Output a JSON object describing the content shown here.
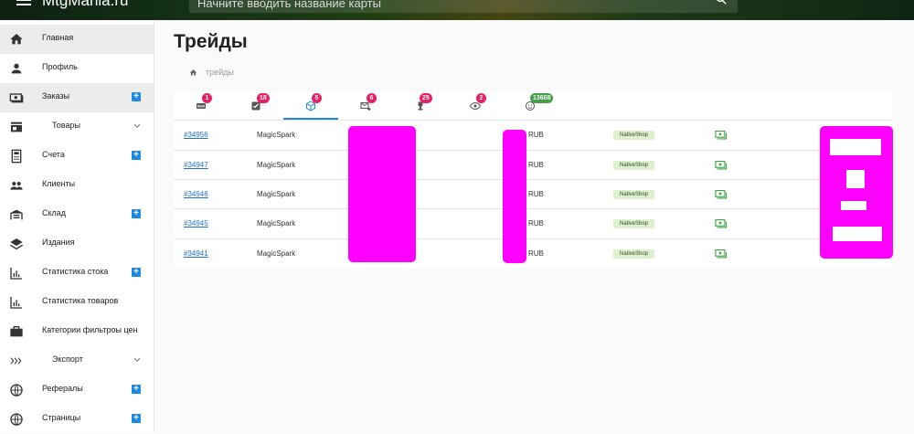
{
  "header": {
    "brand": "MtgMania.ru",
    "search_placeholder": "Начните вводить название карты",
    "menu_icon": "menu-icon",
    "search_icon": "search-icon"
  },
  "sidebar": {
    "items": [
      {
        "label": "Главная",
        "icon": "home-icon",
        "active": true
      },
      {
        "label": "Профиль",
        "icon": "person-icon"
      },
      {
        "label": "Заказы",
        "icon": "money-icon",
        "plus": true
      },
      {
        "label": "Товары",
        "icon": "store-icon",
        "expand": true
      },
      {
        "label": "Счета",
        "icon": "calculator-icon",
        "plus": true
      },
      {
        "label": "Клиенты",
        "icon": "people-icon"
      },
      {
        "label": "Склад",
        "icon": "warehouse-icon",
        "plus": true
      },
      {
        "label": "Издания",
        "icon": "layers-icon"
      },
      {
        "label": "Статистика стока",
        "icon": "chart-icon",
        "plus": true
      },
      {
        "label": "Статистика товаров",
        "icon": "chart-icon"
      },
      {
        "label": "Категории фильтроы цен",
        "icon": "briefcase-icon"
      },
      {
        "label": "Экспорт",
        "icon": "chevrons-right-icon",
        "expand": true
      },
      {
        "label": "Рефералы",
        "icon": "globe-icon",
        "plus": true
      },
      {
        "label": "Страницы",
        "icon": "globe-icon",
        "plus": true
      }
    ]
  },
  "main": {
    "title": "Трейды",
    "breadcrumb": "трейды",
    "tabs": [
      {
        "icon": "new-icon",
        "badge": "1",
        "badge_color": "#e91e63"
      },
      {
        "icon": "check-box-icon",
        "badge": "18",
        "badge_color": "#e91e63"
      },
      {
        "icon": "package-icon",
        "badge": "5",
        "badge_color": "#e91e63",
        "active": true
      },
      {
        "icon": "mail-forward-icon",
        "badge": "6",
        "badge_color": "#e91e63"
      },
      {
        "icon": "trophy-icon",
        "badge": "25",
        "badge_color": "#e91e63"
      },
      {
        "icon": "eye-check-icon",
        "badge": "2",
        "badge_color": "#e91e63"
      },
      {
        "icon": "smile-check-icon",
        "badge": "13668",
        "badge_color": "#43a047"
      }
    ],
    "rows": [
      {
        "id": "#34956",
        "client": "MagicSpark",
        "currency": "RUB",
        "shop": "NativeShop"
      },
      {
        "id": "#34947",
        "client": "MagicSpark",
        "currency": "RUB",
        "shop": "NativeShop"
      },
      {
        "id": "#34946",
        "client": "MagicSpark",
        "currency": "RUB",
        "shop": "NativeShop"
      },
      {
        "id": "#34945",
        "client": "MagicSpark",
        "currency": "RUB",
        "shop": "NativeShop"
      },
      {
        "id": "#34941",
        "client": "MagicSpark",
        "currency": "RUB",
        "shop": "NativeShop"
      }
    ]
  },
  "colors": {
    "accent": "#1e88e5",
    "badge_red": "#e91e63",
    "badge_green": "#43a047",
    "redaction": "#ff00ff",
    "money_icon": "#43a047"
  }
}
